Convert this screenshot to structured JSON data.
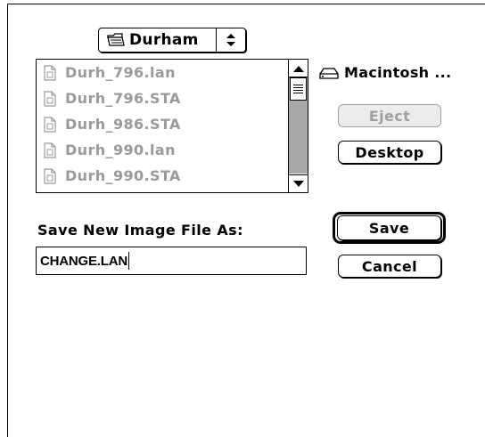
{
  "folder_popup": {
    "label": "Durham",
    "icon": "folder-icon"
  },
  "file_list": {
    "items": [
      {
        "name": "Durh_796.lan",
        "icon": "document-icon"
      },
      {
        "name": "Durh_796.STA",
        "icon": "document-icon"
      },
      {
        "name": "Durh_986.STA",
        "icon": "document-icon"
      },
      {
        "name": "Durh_990.lan",
        "icon": "document-icon"
      },
      {
        "name": "Durh_990.STA",
        "icon": "document-icon"
      }
    ]
  },
  "volume": {
    "name": "Macintosh ...",
    "icon": "hard-disk-icon"
  },
  "buttons": {
    "eject": "Eject",
    "desktop": "Desktop",
    "save": "Save",
    "cancel": "Cancel"
  },
  "save_prompt": "Save New Image File As:",
  "filename_field": {
    "value": "CHANGE.LAN"
  },
  "colors": {
    "disabled_text": "#9a9a9a",
    "scroll_track": "#a8a8a8"
  }
}
